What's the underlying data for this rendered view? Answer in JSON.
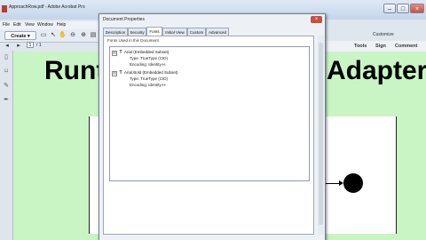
{
  "window": {
    "title": "ApproachRow.pdf - Adobe Acrobat Pro",
    "buttons": {
      "minimize": "–",
      "maximize": "□",
      "close": "×"
    }
  },
  "menu": [
    "File",
    "Edit",
    "View",
    "Window",
    "Help"
  ],
  "toolbar": {
    "create_label": "Create",
    "page_value": "1",
    "page_of": "/ 1"
  },
  "right_toolbar": {
    "customize": "Customize",
    "tools": "Tools",
    "sign": "Sign",
    "comment": "Comment"
  },
  "slide": {
    "title_left": "Runt",
    "title_right": "Adapter"
  },
  "dialog": {
    "title": "Document Properties",
    "close_label": "×",
    "tabs": [
      "Description",
      "Security",
      "Fonts",
      "Initial View",
      "Custom",
      "Advanced"
    ],
    "active_tab": "Fonts",
    "fonts_label": "Fonts Used in this Document",
    "fonts": [
      {
        "name": "Arial (Embedded Subset)",
        "type": "Type: TrueType (CID)",
        "encoding": "Encoding: Identity-H"
      },
      {
        "name": "Arial,Bold (Embedded Subset)",
        "type": "Type: TrueType (CID)",
        "encoding": "Encoding: Identity-H"
      }
    ]
  },
  "icons": {
    "expander": "⊟",
    "font_glyph": "T"
  }
}
